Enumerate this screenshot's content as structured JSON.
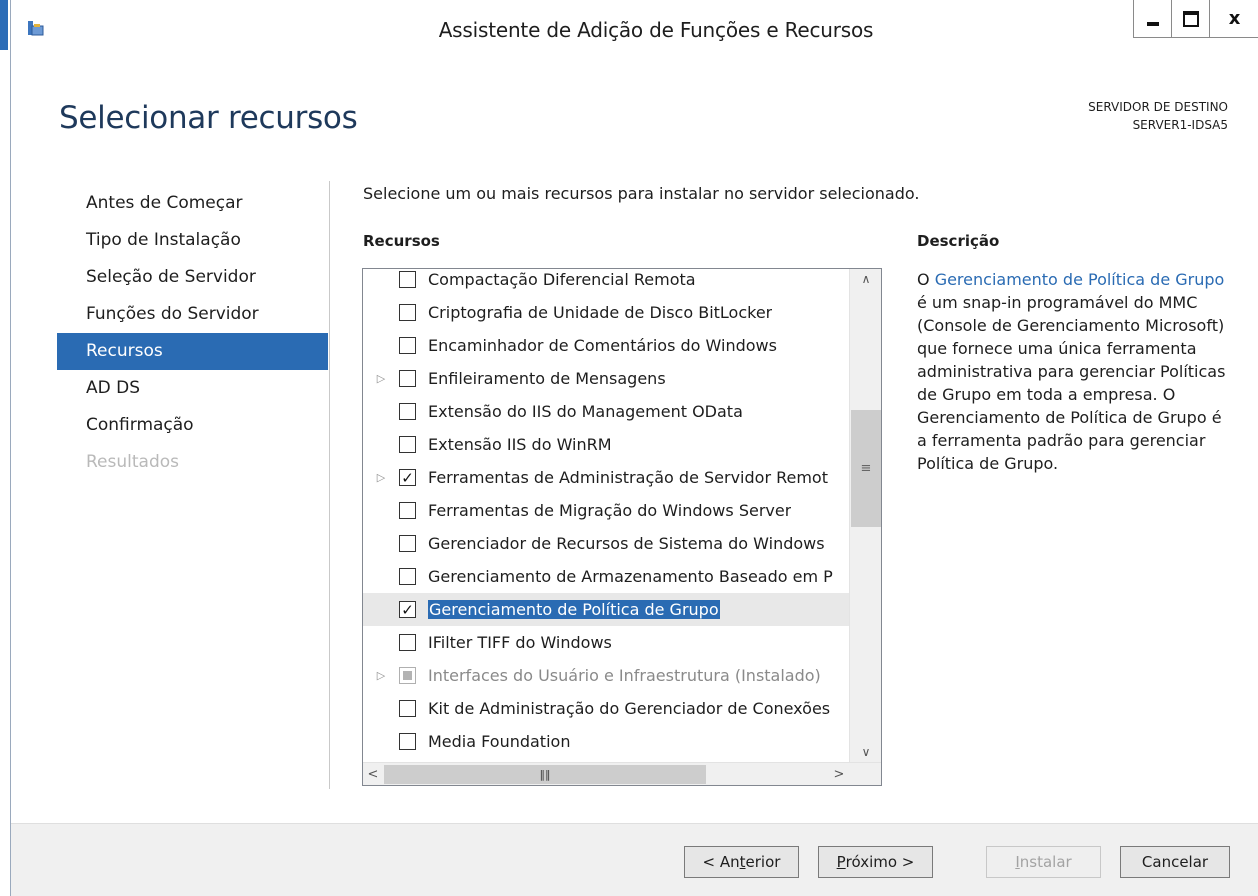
{
  "window": {
    "title": "Assistente de Adição de Funções e Recursos",
    "controls": {
      "minimize": "minimize",
      "maximize": "maximize",
      "close": "x"
    }
  },
  "page": {
    "title": "Selecionar recursos",
    "destination_label": "SERVIDOR DE DESTINO",
    "destination_server": "SERVER1-IDSA5"
  },
  "nav": {
    "items": [
      {
        "label": "Antes de Começar",
        "state": "normal"
      },
      {
        "label": "Tipo de Instalação",
        "state": "normal"
      },
      {
        "label": "Seleção de Servidor",
        "state": "normal"
      },
      {
        "label": "Funções do Servidor",
        "state": "normal"
      },
      {
        "label": "Recursos",
        "state": "active"
      },
      {
        "label": "AD DS",
        "state": "normal"
      },
      {
        "label": "Confirmação",
        "state": "normal"
      },
      {
        "label": "Resultados",
        "state": "disabled"
      }
    ]
  },
  "main": {
    "intro": "Selecione um ou mais recursos para instalar no servidor selecionado.",
    "features_header": "Recursos",
    "description_header": "Descrição",
    "features": [
      {
        "label": "Compactação Diferencial Remota",
        "checked": false,
        "expandable": false,
        "state": "partial-visible"
      },
      {
        "label": "Criptografia de Unidade de Disco BitLocker",
        "checked": false,
        "expandable": false
      },
      {
        "label": "Encaminhador de Comentários do Windows",
        "checked": false,
        "expandable": false
      },
      {
        "label": "Enfileiramento de Mensagens",
        "checked": false,
        "expandable": true
      },
      {
        "label": "Extensão do IIS do Management OData",
        "checked": false,
        "expandable": false
      },
      {
        "label": "Extensão IIS do WinRM",
        "checked": false,
        "expandable": false
      },
      {
        "label": "Ferramentas de Administração de Servidor Remot",
        "checked": true,
        "expandable": true
      },
      {
        "label": "Ferramentas de Migração do Windows Server",
        "checked": false,
        "expandable": false
      },
      {
        "label": "Gerenciador de Recursos de Sistema do Windows",
        "checked": false,
        "expandable": false
      },
      {
        "label": "Gerenciamento de Armazenamento Baseado em P",
        "checked": false,
        "expandable": false
      },
      {
        "label": "Gerenciamento de Política de Grupo",
        "checked": true,
        "expandable": false,
        "selected": true
      },
      {
        "label": "IFilter TIFF do Windows",
        "checked": false,
        "expandable": false
      },
      {
        "label": "Interfaces do Usuário e Infraestrutura (Instalado)",
        "checked": "indeterminate",
        "expandable": true,
        "disabled": true
      },
      {
        "label": "Kit de Administração do Gerenciador de Conexões",
        "checked": false,
        "expandable": false
      },
      {
        "label": "Media Foundation",
        "checked": false,
        "expandable": false
      }
    ],
    "description": {
      "prefix": "O ",
      "link": "Gerenciamento de Política de Grupo",
      "body": " é um snap-in programável do MMC (Console de Gerenciamento Microsoft) que fornece uma única ferramenta administrativa para gerenciar Políticas de Grupo em toda a empresa. O Gerenciamento de Política de Grupo é a ferramenta padrão para gerenciar Política de Grupo."
    }
  },
  "footer": {
    "previous": {
      "before": "< An",
      "accel": "t",
      "after": "erior"
    },
    "next": {
      "before": "",
      "accel": "P",
      "after": "róximo >"
    },
    "install": {
      "before": "",
      "accel": "I",
      "after": "nstalar"
    },
    "cancel": "Cancelar"
  },
  "colors": {
    "accent": "#2a6bb3",
    "title": "#1e395b",
    "disabled": "#b9b9b9"
  }
}
